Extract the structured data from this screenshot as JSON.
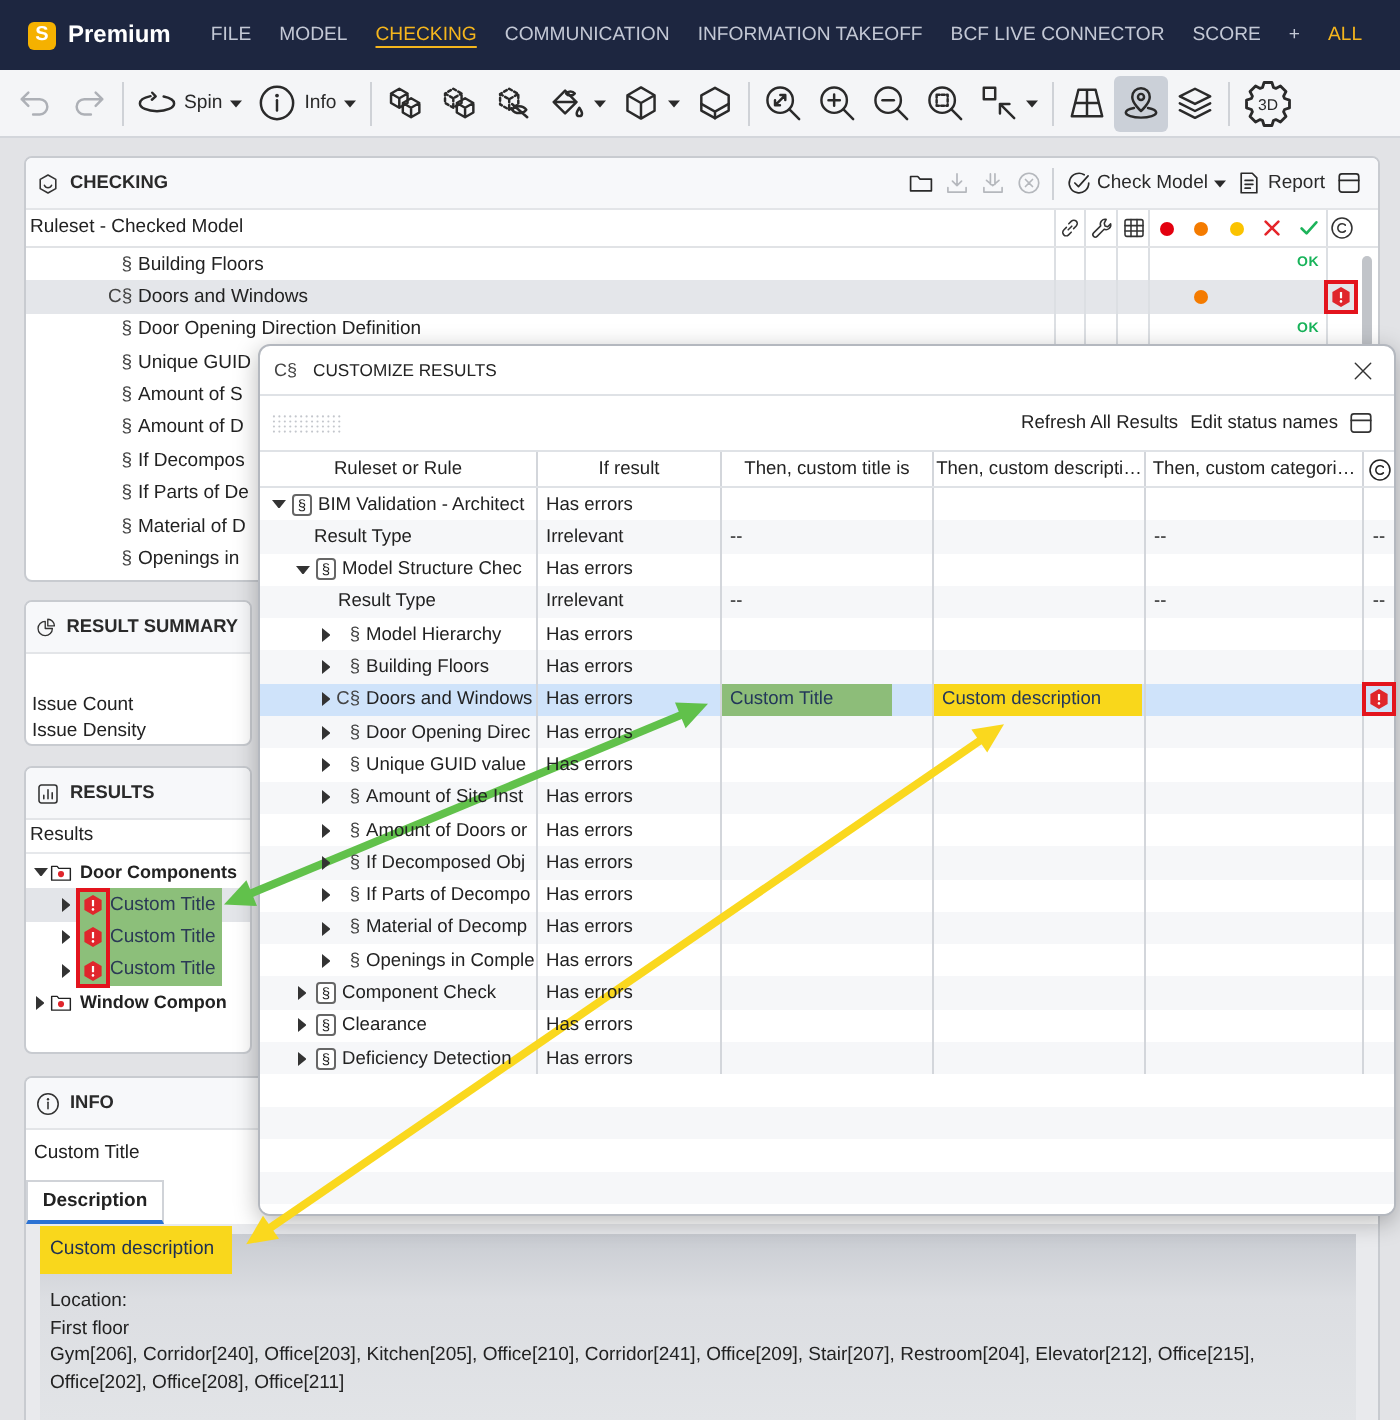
{
  "app": {
    "logo": "S",
    "title": "Premium"
  },
  "menu": [
    {
      "label": "FILE",
      "selected": false
    },
    {
      "label": "MODEL",
      "selected": false
    },
    {
      "label": "CHECKING",
      "selected": true
    },
    {
      "label": "COMMUNICATION",
      "selected": false
    },
    {
      "label": "INFORMATION TAKEOFF",
      "selected": false
    },
    {
      "label": "BCF LIVE CONNECTOR",
      "selected": false
    },
    {
      "label": "SCORE",
      "selected": false
    }
  ],
  "menu_add": "+",
  "menu_extra": "ALL",
  "toolbar": [
    [
      {
        "kind": "undo",
        "disabled": true,
        "dropdown": false,
        "selected": false
      },
      {
        "kind": "redo",
        "disabled": true,
        "dropdown": false,
        "selected": false
      }
    ],
    [
      {
        "kind": "spin",
        "label": "Spin",
        "disabled": false,
        "dropdown": true,
        "selected": false
      },
      {
        "kind": "info",
        "label": "Info",
        "disabled": false,
        "dropdown": true,
        "selected": false
      }
    ],
    [
      {
        "kind": "cubes",
        "disabled": false,
        "dropdown": false,
        "selected": false
      },
      {
        "kind": "cubes_dashed",
        "disabled": false,
        "dropdown": false,
        "selected": false
      },
      {
        "kind": "hide",
        "disabled": false,
        "dropdown": false,
        "selected": false
      },
      {
        "kind": "paint",
        "disabled": false,
        "dropdown": true,
        "selected": false
      },
      {
        "kind": "cube",
        "disabled": false,
        "dropdown": true,
        "selected": false
      },
      {
        "kind": "section_box",
        "disabled": false,
        "dropdown": false,
        "selected": false
      }
    ],
    [
      {
        "kind": "zoom_extents",
        "disabled": false,
        "dropdown": false,
        "selected": false
      },
      {
        "kind": "zoom_in",
        "disabled": false,
        "dropdown": false,
        "selected": false
      },
      {
        "kind": "zoom_out",
        "disabled": false,
        "dropdown": false,
        "selected": false
      },
      {
        "kind": "zoom_fit",
        "disabled": false,
        "dropdown": false,
        "selected": false
      },
      {
        "kind": "select",
        "disabled": false,
        "dropdown": true,
        "selected": false
      }
    ],
    [
      {
        "kind": "floor_grid",
        "disabled": false,
        "dropdown": false,
        "selected": false
      },
      {
        "kind": "pin",
        "disabled": false,
        "dropdown": false,
        "selected": true
      },
      {
        "kind": "layers",
        "disabled": false,
        "dropdown": false,
        "selected": false
      }
    ],
    [
      {
        "kind": "view_3d",
        "label": "3D",
        "disabled": false,
        "dropdown": false,
        "selected": false
      }
    ]
  ],
  "checking": {
    "title": "CHECKING",
    "actions": [
      {
        "kind": "folder",
        "disabled": false,
        "dropdown": false
      },
      {
        "kind": "download",
        "disabled": true,
        "dropdown": false
      },
      {
        "kind": "download_all",
        "disabled": true,
        "dropdown": false
      },
      {
        "kind": "cancel",
        "disabled": true,
        "dropdown": false
      },
      {
        "kind": "separator"
      },
      {
        "kind": "check_model",
        "label": "Check Model",
        "disabled": false,
        "dropdown": true
      },
      {
        "kind": "report",
        "label": "Report",
        "disabled": false,
        "dropdown": false
      },
      {
        "kind": "window",
        "disabled": false,
        "dropdown": false
      }
    ],
    "column_title": "Ruleset - Checked Model",
    "status_columns": [
      {
        "kind": "dot",
        "color": "#e3000f"
      },
      {
        "kind": "dot",
        "color": "#f47b00"
      },
      {
        "kind": "dot",
        "color": "#fbc300"
      },
      {
        "kind": "cross",
        "color": "#e5262b"
      },
      {
        "kind": "check",
        "color": "#1db35a"
      }
    ],
    "rows": [
      {
        "symbol": "§",
        "name": "Building Floors",
        "selected": false,
        "warning": false,
        "ok_label": "OK"
      },
      {
        "symbol": "C§",
        "name": "Doors and Windows",
        "selected": true,
        "warning": true,
        "custom_status": true,
        "marked": true
      },
      {
        "symbol": "§",
        "name": "Door Opening Direction Definition",
        "selected": false,
        "warning": false,
        "ok_label": "OK"
      },
      {
        "symbol": "§",
        "name": "Unique GUID",
        "selected": false
      },
      {
        "symbol": "§",
        "name": "Amount of S",
        "selected": false
      },
      {
        "symbol": "§",
        "name": "Amount of D",
        "selected": false
      },
      {
        "symbol": "§",
        "name": "If Decompos",
        "selected": false
      },
      {
        "symbol": "§",
        "name": "If Parts of De",
        "selected": false
      },
      {
        "symbol": "§",
        "name": "Material of D",
        "selected": false
      },
      {
        "symbol": "§",
        "name": "Openings in",
        "selected": false
      }
    ]
  },
  "result_summary": {
    "title": "RESULT SUMMARY",
    "rows": [
      "Issue Count",
      "Issue Density"
    ]
  },
  "results": {
    "title": "RESULTS",
    "column_title": "Results",
    "tree": [
      {
        "kind": "category",
        "name": "Door Components",
        "expanded": true,
        "selected": false,
        "children": [
          {
            "kind": "issue",
            "name": "Custom Title",
            "expanded": false,
            "selected": true,
            "color": "#8cbf7a",
            "marked": true
          },
          {
            "kind": "issue",
            "name": "Custom Title",
            "expanded": false,
            "selected": false,
            "color": "#8cbf7a",
            "marked": true
          },
          {
            "kind": "issue",
            "name": "Custom Title",
            "expanded": false,
            "selected": false,
            "color": "#8cbf7a",
            "marked": true
          }
        ]
      },
      {
        "kind": "category",
        "name": "Window Compon",
        "expanded": false,
        "selected": false
      }
    ]
  },
  "info": {
    "title": "INFO",
    "subtitle": "Custom Title",
    "tabs": [
      {
        "label": "Description",
        "selected": true
      }
    ],
    "highlight": {
      "text": "Custom description",
      "color": "#f9d71c"
    },
    "lines": [
      "Location:",
      "First floor",
      "Gym[206], Corridor[240], Office[203], Kitchen[205], Office[210], Corridor[241], Office[209], Stair[207], Restroom[204], Elevator[212], Office[215], Office[202], Office[208], Office[211]"
    ]
  },
  "dialog": {
    "symbol": "C§",
    "title": "CUSTOMIZE RESULTS",
    "actions": [
      "Refresh All Results",
      "Edit status names"
    ],
    "columns": [
      "Ruleset or Rule",
      "If result",
      "Then, custom title is",
      "Then, custom descripti…",
      "Then, custom categori…"
    ],
    "rules": [
      {
        "kind": "ruleset",
        "symbol": "§",
        "name": "BIM Validation - Architect",
        "expanded": true,
        "selected": false,
        "if_result": "Has errors",
        "children": [
          {
            "kind": "result_type",
            "name": "Result Type",
            "selected": false,
            "if_result": "Irrelevant",
            "custom_title": "--",
            "custom_category": "--",
            "status": "--"
          },
          {
            "kind": "ruleset",
            "symbol": "§",
            "name": "Model Structure Chec",
            "expanded": true,
            "selected": false,
            "if_result": "Has errors",
            "children": [
              {
                "kind": "result_type",
                "name": "Result Type",
                "selected": false,
                "if_result": "Irrelevant",
                "custom_title": "--",
                "custom_category": "--",
                "status": "--"
              },
              {
                "kind": "rule",
                "symbol": "§",
                "name": "Model Hierarchy",
                "expanded": false,
                "selected": false,
                "if_result": "Has errors"
              },
              {
                "kind": "rule",
                "symbol": "§",
                "name": "Building Floors",
                "expanded": false,
                "selected": false,
                "if_result": "Has errors"
              },
              {
                "kind": "rule",
                "symbol": "C§",
                "name": "Doors and Windows",
                "expanded": false,
                "selected": true,
                "if_result": "Has errors",
                "custom_title": {
                  "text": "Custom Title",
                  "color": "#8dbd79"
                },
                "custom_description": {
                  "text": "Custom description",
                  "color": "#f9d71b"
                },
                "status_icon": true,
                "marked": true
              },
              {
                "kind": "rule",
                "symbol": "§",
                "name": "Door Opening Direc",
                "expanded": false,
                "selected": false,
                "if_result": "Has errors"
              },
              {
                "kind": "rule",
                "symbol": "§",
                "name": "Unique GUID value",
                "expanded": false,
                "selected": false,
                "if_result": "Has errors"
              },
              {
                "kind": "rule",
                "symbol": "§",
                "name": "Amount of Site Inst",
                "expanded": false,
                "selected": false,
                "if_result": "Has errors"
              },
              {
                "kind": "rule",
                "symbol": "§",
                "name": "Amount of Doors or",
                "expanded": false,
                "selected": false,
                "if_result": "Has errors"
              },
              {
                "kind": "rule",
                "symbol": "§",
                "name": "If Decomposed Obj",
                "expanded": false,
                "selected": false,
                "if_result": "Has errors"
              },
              {
                "kind": "rule",
                "symbol": "§",
                "name": "If Parts of Decompo",
                "expanded": false,
                "selected": false,
                "if_result": "Has errors"
              },
              {
                "kind": "rule",
                "symbol": "§",
                "name": "Material of Decomp",
                "expanded": false,
                "selected": false,
                "if_result": "Has errors"
              },
              {
                "kind": "rule",
                "symbol": "§",
                "name": "Openings in Comple",
                "expanded": false,
                "selected": false,
                "if_result": "Has errors"
              }
            ]
          },
          {
            "kind": "ruleset",
            "symbol": "§",
            "name": "Component Check",
            "expanded": false,
            "selected": false,
            "if_result": "Has errors"
          },
          {
            "kind": "ruleset",
            "symbol": "§",
            "name": "Clearance",
            "expanded": false,
            "selected": false,
            "if_result": "Has errors"
          },
          {
            "kind": "ruleset",
            "symbol": "§",
            "name": "Deficiency Detection",
            "expanded": false,
            "selected": false,
            "if_result": "Has errors"
          }
        ]
      }
    ]
  },
  "annotations": {
    "arrows": [
      {
        "kind": "title_link",
        "color": "#61c14b"
      },
      {
        "kind": "description_link",
        "color": "#fad81e"
      }
    ]
  }
}
